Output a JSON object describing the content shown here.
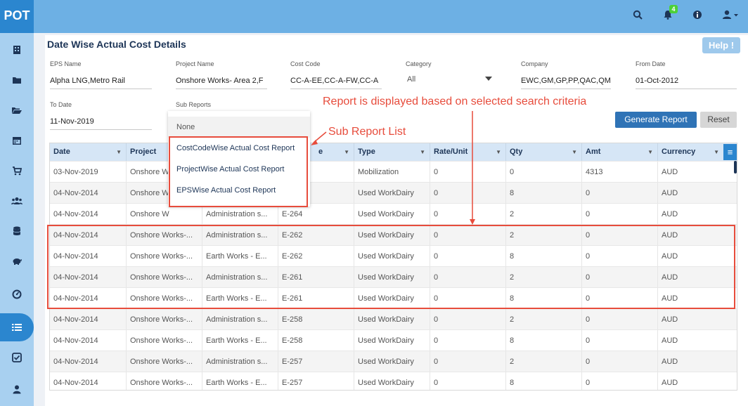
{
  "app": {
    "logo": "POT",
    "notifications_count": "4"
  },
  "topbar_icons": [
    "search-icon",
    "bell-icon",
    "info-icon",
    "user-menu-icon"
  ],
  "sidebar_icons": [
    "building-icon",
    "folder-icon",
    "folder-open-icon",
    "calendar-icon",
    "cart-icon",
    "users-icon",
    "database-icon",
    "piggy-bank-icon",
    "dashboard-icon",
    "list-icon",
    "checklist-icon",
    "user-icon"
  ],
  "sidebar_active": "list-icon",
  "page": {
    "title": "Date Wise Actual Cost Details",
    "help_label": "Help !"
  },
  "filters": {
    "eps_name": {
      "label": "EPS Name",
      "value": "Alpha LNG,Metro Rail"
    },
    "project_name": {
      "label": "Project Name",
      "value": "Onshore  Works- Area 2,F"
    },
    "cost_code": {
      "label": "Cost Code",
      "value": "CC-A-EE,CC-A-FW,CC-A"
    },
    "category": {
      "label": "Category",
      "value": "All"
    },
    "company": {
      "label": "Company",
      "value": "EWC,GM,GP,PP,QAC,QM"
    },
    "from_date": {
      "label": "From Date",
      "value": "01-Oct-2012"
    },
    "to_date": {
      "label": "To Date",
      "value": "11-Nov-2019"
    },
    "sub_reports": {
      "label": "Sub Reports"
    }
  },
  "buttons": {
    "generate": "Generate Report",
    "reset": "Reset"
  },
  "sub_report_options": [
    "None",
    "CostCodeWise Actual Cost Report",
    "ProjectWise Actual Cost Report",
    "EPSWise Actual Cost Report"
  ],
  "table": {
    "columns": [
      "Date",
      "Project",
      "",
      "e",
      "Type",
      "Rate/Unit",
      "Qty",
      "Amt",
      "Currency"
    ],
    "rows": [
      [
        "03-Nov-2019",
        "Onshore W",
        "",
        "",
        "Mobilization",
        "0",
        "0",
        "4313",
        "AUD"
      ],
      [
        "04-Nov-2014",
        "Onshore W",
        "",
        "",
        "Used WorkDairy",
        "0",
        "8",
        "0",
        "AUD"
      ],
      [
        "04-Nov-2014",
        "Onshore W",
        "Administration s...",
        "E-264",
        "Used WorkDairy",
        "0",
        "2",
        "0",
        "AUD"
      ],
      [
        "04-Nov-2014",
        "Onshore Works-...",
        "Administration s...",
        "E-262",
        "Used WorkDairy",
        "0",
        "2",
        "0",
        "AUD"
      ],
      [
        "04-Nov-2014",
        "Onshore Works-...",
        "Earth Works - E...",
        "E-262",
        "Used WorkDairy",
        "0",
        "8",
        "0",
        "AUD"
      ],
      [
        "04-Nov-2014",
        "Onshore Works-...",
        "Administration s...",
        "E-261",
        "Used WorkDairy",
        "0",
        "2",
        "0",
        "AUD"
      ],
      [
        "04-Nov-2014",
        "Onshore Works-...",
        "Earth Works - E...",
        "E-261",
        "Used WorkDairy",
        "0",
        "8",
        "0",
        "AUD"
      ],
      [
        "04-Nov-2014",
        "Onshore Works-...",
        "Administration s...",
        "E-258",
        "Used WorkDairy",
        "0",
        "2",
        "0",
        "AUD"
      ],
      [
        "04-Nov-2014",
        "Onshore Works-...",
        "Earth Works - E...",
        "E-258",
        "Used WorkDairy",
        "0",
        "8",
        "0",
        "AUD"
      ],
      [
        "04-Nov-2014",
        "Onshore Works-...",
        "Administration s...",
        "E-257",
        "Used WorkDairy",
        "0",
        "2",
        "0",
        "AUD"
      ],
      [
        "04-Nov-2014",
        "Onshore Works-...",
        "Earth Works - E...",
        "E-257",
        "Used WorkDairy",
        "0",
        "8",
        "0",
        "AUD"
      ]
    ]
  },
  "annotations": {
    "report_note": "Report is displayed based on selected search criteria",
    "sub_report_note": "Sub Report List",
    "color": "#e74c3c"
  }
}
